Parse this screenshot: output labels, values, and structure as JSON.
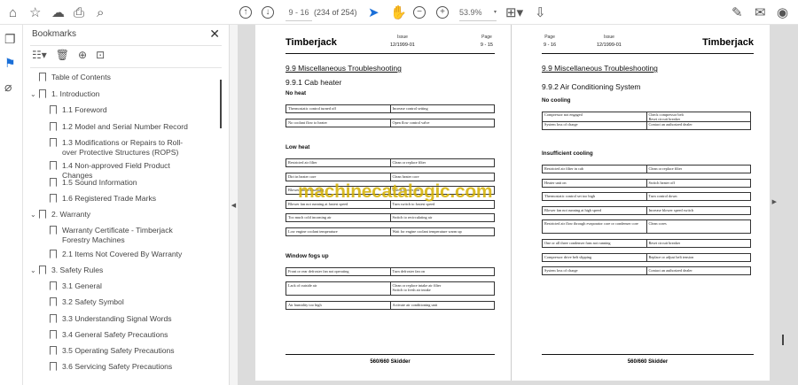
{
  "toolbar": {
    "page_input": "9 - 16",
    "page_count": "(234 of 254)",
    "zoom": "53.9%",
    "icons": [
      "home-icon",
      "star-icon",
      "cloud-upload-icon",
      "print-icon",
      "zoom-search-icon",
      "prev-page-icon",
      "next-page-icon",
      "select-cursor-icon",
      "hand-icon",
      "zoom-out-icon",
      "zoom-in-icon",
      "page-fit-icon",
      "scroll-mode-icon",
      "edit-sign-icon",
      "mail-icon",
      "account-icon"
    ]
  },
  "bookmarks": {
    "title": "Bookmarks",
    "items": [
      {
        "label": "Table of Contents",
        "level": 0,
        "expand": false
      },
      {
        "label": "1.  Introduction",
        "level": 0,
        "expand": true
      },
      {
        "label": "1.1  Foreword",
        "level": 1
      },
      {
        "label": "1.2  Model and Serial Number Record",
        "level": 1
      },
      {
        "label": "1.3  Modifications or Repairs to Roll-over Protective Structures (ROPS)",
        "level": 1
      },
      {
        "label": "1.4  Non-approved Field Product Changes",
        "level": 1
      },
      {
        "label": "1.5  Sound Information",
        "level": 1
      },
      {
        "label": "1.6  Registered Trade Marks",
        "level": 1
      },
      {
        "label": "2.  Warranty",
        "level": 0,
        "expand": true
      },
      {
        "label": "Warranty Certificate - Timberjack Forestry Machines",
        "level": 1
      },
      {
        "label": "2.1  Items Not Covered By Warranty",
        "level": 1
      },
      {
        "label": "3.  Safety Rules",
        "level": 0,
        "expand": true
      },
      {
        "label": "3.1  General",
        "level": 1
      },
      {
        "label": "3.2  Safety Symbol",
        "level": 1
      },
      {
        "label": "3.3  Understanding Signal Words",
        "level": 1
      },
      {
        "label": "3.4  General Safety Precautions",
        "level": 1
      },
      {
        "label": "3.5  Operating Safety Precautions",
        "level": 1
      },
      {
        "label": "3.6  Servicing Safety Precautions",
        "level": 1
      }
    ]
  },
  "left_page": {
    "brand": "Timberjack",
    "issue_label": "Issue",
    "issue": "12/1999-01",
    "page_label": "Page",
    "page": "9 - 15",
    "section": "9.9  Miscellaneous Troubleshooting",
    "subsection": "9.9.1  Cab heater",
    "groups": [
      {
        "title": "No heat",
        "rows": [
          [
            "Thermostatic control turned off",
            "Increase control setting"
          ],
          [
            "No coolant flow to heater",
            "Open flow control valve"
          ]
        ]
      },
      {
        "title": "Low heat",
        "rows": [
          [
            "Restricted air filter",
            "Clean or replace filter"
          ],
          [
            "Dirt in heater core",
            "Clean heater core"
          ],
          [
            "Blower fan not running",
            "Check blower fan"
          ],
          [
            "Blower fan not running at fastest speed",
            "Turn switch to fastest speed"
          ],
          [
            "Too much cold incoming air",
            "Switch to recirculating air"
          ],
          [
            "Low engine coolant temperature",
            "Wait for engine coolant temperature warm up"
          ]
        ]
      },
      {
        "title": "Window fogs up",
        "rows": [
          [
            "Front or rear defroster fan not operating",
            "Turn defroster fan on"
          ],
          [
            "Lack of outside air",
            "Clean or replace intake air filter\nSwitch to fresh air intake"
          ],
          [
            "Air humidity too high",
            "Activate air conditioning unit"
          ]
        ]
      }
    ],
    "footer": "560/660 Skidder"
  },
  "right_page": {
    "brand": "Timberjack",
    "issue_label": "Issue",
    "issue": "12/1999-01",
    "page_label": "Page",
    "page": "9 - 16",
    "section": "9.9 Miscellaneous Troubleshooting",
    "subsection": "9.9.2  Air Conditioning System",
    "groups": [
      {
        "title": "No cooling",
        "rows": [
          [
            "Compressor not engaged",
            "Check compressor belt\nReset circuit breaker"
          ],
          [
            "System loss of charge",
            "Contact an authorized dealer"
          ]
        ]
      },
      {
        "title": "Insufficient cooling",
        "rows": [
          [
            "Restricted air filter in cab",
            "Clean or replace filter"
          ],
          [
            "Heater unit on",
            "Switch heater off"
          ],
          [
            "Thermostatic control set too high",
            "Turn control down"
          ],
          [
            "Blower fan not running at high speed",
            "Increase blower speed switch"
          ],
          [
            "Restricted air flow through evaporator core or condenser core",
            "Clean cores"
          ],
          [
            "One or all three condenser fans not running",
            "Reset circuit breaker"
          ],
          [
            "Compressor drive belt slipping",
            "Replace or adjust belt tension"
          ],
          [
            "System loss of charge",
            "Contact an authorized dealer"
          ]
        ]
      }
    ],
    "footer": "560/660 Skidder"
  },
  "watermark": "machinecatalogic.com"
}
